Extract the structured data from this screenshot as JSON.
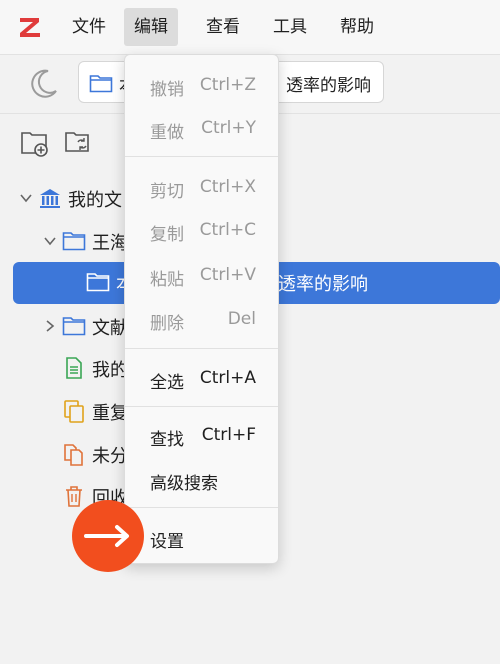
{
  "app": {
    "logo_letter": "Z"
  },
  "menubar": {
    "items": [
      {
        "label": "文件"
      },
      {
        "label": "编辑"
      },
      {
        "label": "查看"
      },
      {
        "label": "工具"
      },
      {
        "label": "帮助"
      }
    ],
    "active_index": 1
  },
  "toolbar": {
    "breadcrumb_text_left": "本",
    "breadcrumb_text_right": "透率的影响"
  },
  "tree": {
    "items": [
      {
        "label": "我的文"
      },
      {
        "label": "王海"
      },
      {
        "label_left": "本",
        "label_right": "透率的影响"
      },
      {
        "label": "文献"
      },
      {
        "label": "我的"
      },
      {
        "label": "重复"
      },
      {
        "label": "未分"
      },
      {
        "label": "回收"
      }
    ]
  },
  "edit_menu": {
    "items": [
      {
        "label": "撤销",
        "shortcut": "Ctrl+Z",
        "enabled": false
      },
      {
        "label": "重做",
        "shortcut": "Ctrl+Y",
        "enabled": false
      },
      {
        "label": "剪切",
        "shortcut": "Ctrl+X",
        "enabled": false
      },
      {
        "label": "复制",
        "shortcut": "Ctrl+C",
        "enabled": false
      },
      {
        "label": "粘贴",
        "shortcut": "Ctrl+V",
        "enabled": false
      },
      {
        "label": "删除",
        "shortcut": "Del",
        "enabled": false
      },
      {
        "label": "全选",
        "shortcut": "Ctrl+A",
        "enabled": true
      },
      {
        "label": "查找",
        "shortcut": "Ctrl+F",
        "enabled": true
      },
      {
        "label": "高级搜索",
        "shortcut": "",
        "enabled": true
      },
      {
        "label": "设置",
        "shortcut": "",
        "enabled": true
      }
    ]
  },
  "colors": {
    "accent": "#3d77d9",
    "logo_red": "#e03b3b",
    "badge_orange": "#f24e1e"
  }
}
